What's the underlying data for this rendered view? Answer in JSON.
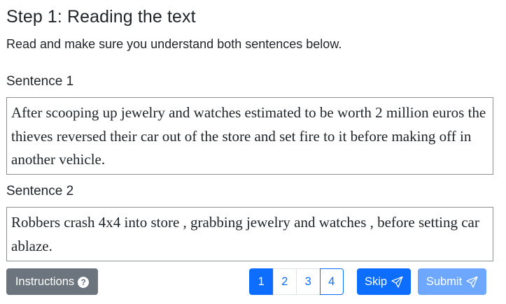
{
  "header": {
    "title": "Step 1: Reading the text",
    "instructions_text": "Read and make sure you understand both sentences below."
  },
  "sentences": [
    {
      "label": "Sentence 1",
      "text": "After scooping up jewelry and watches estimated to be worth 2 million euros the thieves reversed their car out of the store and set fire to it before making off in another vehicle."
    },
    {
      "label": "Sentence 2",
      "text": "Robbers crash 4x4 into store , grabbing jewelry and watches , before setting car ablaze."
    }
  ],
  "footer": {
    "instructions_button": "Instructions",
    "help_icon": "?",
    "pages": [
      "1",
      "2",
      "3",
      "4"
    ],
    "active_page": "1",
    "skip_button": "Skip",
    "submit_button": "Submit"
  },
  "colors": {
    "primary": "#0d6efd",
    "secondary": "#6c757d",
    "disabled_primary": "#6ea8fe"
  }
}
